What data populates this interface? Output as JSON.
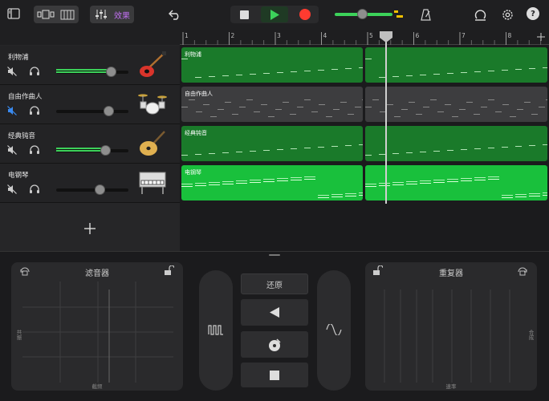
{
  "toolbar": {
    "fx_label": "效果"
  },
  "ruler": {
    "bars": [
      "1",
      "2",
      "3",
      "4",
      "5",
      "6",
      "7",
      "8"
    ]
  },
  "tracks": [
    {
      "name": "利物浦",
      "region_label": "利物浦",
      "volume": 0.75,
      "muted": true
    },
    {
      "name": "自由作曲人",
      "region_label": "自由作曲人",
      "volume": 0.72,
      "muted": true
    },
    {
      "name": "经典钝音",
      "region_label": "经典钝音",
      "volume": 0.68,
      "muted": true
    },
    {
      "name": "电钢琴",
      "region_label": "电钢琴",
      "volume": 0.6,
      "muted": true
    }
  ],
  "fx": {
    "left_pad_title": "滤音器",
    "left_pad_y_label": "共振",
    "left_pad_x_label": "截频",
    "restore_label": "还原",
    "right_pad_title": "重复器",
    "right_pad_y_label": "合成",
    "right_pad_x_label": "速率"
  },
  "colors": {
    "accent_green": "#3cd25a",
    "region_green": "#1a7a2a",
    "region_bright": "#19c03c",
    "region_gray": "#3d3d3f",
    "record_red": "#ff3b30",
    "fx_purple": "#c070f0"
  }
}
